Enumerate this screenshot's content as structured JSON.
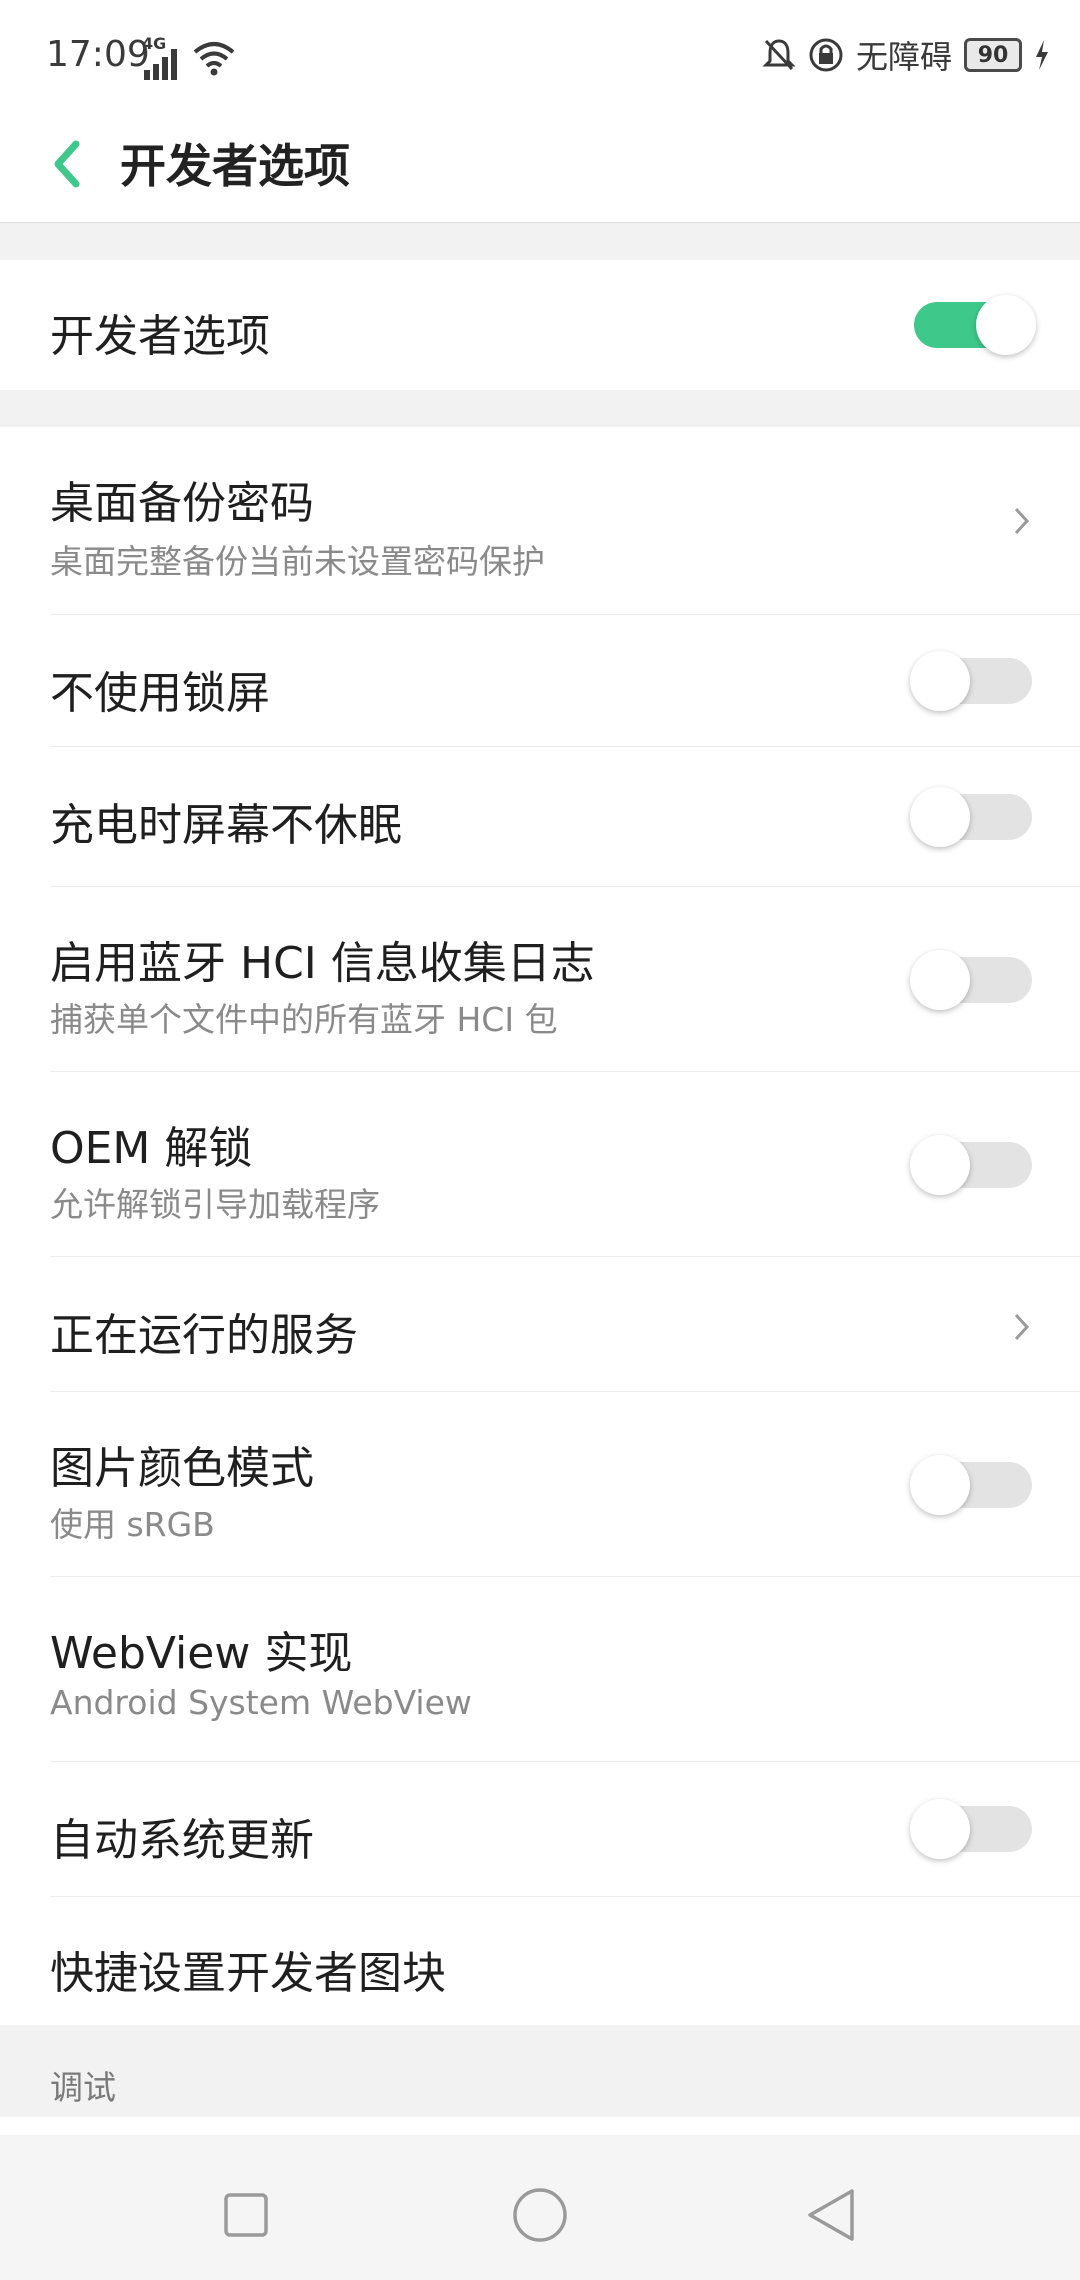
{
  "status_bar": {
    "time": "17:09",
    "network": "4G",
    "accessibility_label": "无障碍",
    "battery_level": "90"
  },
  "header": {
    "title": "开发者选项",
    "back_icon": "chevron-left-icon",
    "accent_color": "#3ec98a"
  },
  "master_toggle": {
    "label": "开发者选项",
    "checked": true
  },
  "settings": [
    {
      "title": "桌面备份密码",
      "subtitle": "桌面完整备份当前未设置密码保护",
      "control": "chevron"
    },
    {
      "title": "不使用锁屏",
      "control": "switch",
      "checked": false
    },
    {
      "title": "充电时屏幕不休眠",
      "control": "switch",
      "checked": false
    },
    {
      "title": "启用蓝牙 HCI 信息收集日志",
      "subtitle": "捕获单个文件中的所有蓝牙 HCI 包",
      "control": "switch",
      "checked": false
    },
    {
      "title": "OEM 解锁",
      "subtitle": "允许解锁引导加载程序",
      "control": "switch",
      "checked": false
    },
    {
      "title": "正在运行的服务",
      "control": "chevron"
    },
    {
      "title": "图片颜色模式",
      "subtitle": "使用 sRGB",
      "control": "switch",
      "checked": false
    },
    {
      "title": "WebView 实现",
      "subtitle": "Android System WebView",
      "control": "none"
    },
    {
      "title": "自动系统更新",
      "control": "switch",
      "checked": false
    },
    {
      "title": "快捷设置开发者图块",
      "control": "none"
    }
  ],
  "section_debug": {
    "label": "调试"
  },
  "nav_bar": {
    "buttons": [
      "recents-icon",
      "home-icon",
      "back-triangle-icon"
    ]
  }
}
